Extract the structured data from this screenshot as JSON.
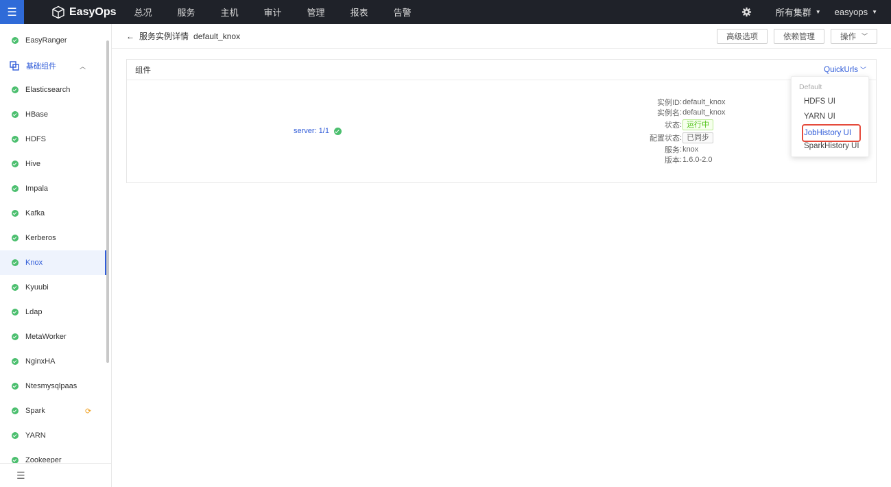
{
  "app": {
    "logo_text": "EasyOps",
    "nav": [
      "总况",
      "服务",
      "主机",
      "审计",
      "管理",
      "报表",
      "告警"
    ],
    "cluster_label": "所有集群",
    "user_label": "easyops"
  },
  "sidebar": {
    "top_item": "EasyRanger",
    "group_label": "基础组件",
    "items": [
      "Elasticsearch",
      "HBase",
      "HDFS",
      "Hive",
      "Impala",
      "Kafka",
      "Kerberos",
      "Knox",
      "Kyuubi",
      "Ldap",
      "MetaWorker",
      "NginxHA",
      "Ntesmysqlpaas",
      "Spark",
      "YARN",
      "Zookeeper"
    ],
    "active_item": "Knox"
  },
  "header": {
    "title": "服务实例详情",
    "instance": "default_knox",
    "buttons": {
      "advanced": "高级选项",
      "deps": "依赖管理",
      "ops": "操作"
    }
  },
  "panel": {
    "title": "组件",
    "quickurls_label": "QuickUrls",
    "server_label": "server",
    "server_count": ": 1/1",
    "info": [
      {
        "key": "实例ID",
        "value": "default_knox"
      },
      {
        "key": "实例名",
        "value": "default_knox"
      },
      {
        "key": "状态",
        "value": "运行中",
        "tag": "green"
      },
      {
        "key": "配置状态",
        "value": "已同步",
        "tag": "grey"
      },
      {
        "key": "服务",
        "value": "knox"
      },
      {
        "key": "版本",
        "value": "1.6.0-2.0"
      }
    ]
  },
  "quickurls_menu": {
    "group": "Default",
    "items": [
      "HDFS UI",
      "YARN UI",
      "JobHistory UI",
      "SparkHistory UI"
    ],
    "highlighted": "JobHistory UI"
  },
  "colors": {
    "accent": "#2f5bd8",
    "topbar": "#1f2229",
    "ok": "#4cbf6f",
    "highlight_box": "#e54b3c"
  }
}
